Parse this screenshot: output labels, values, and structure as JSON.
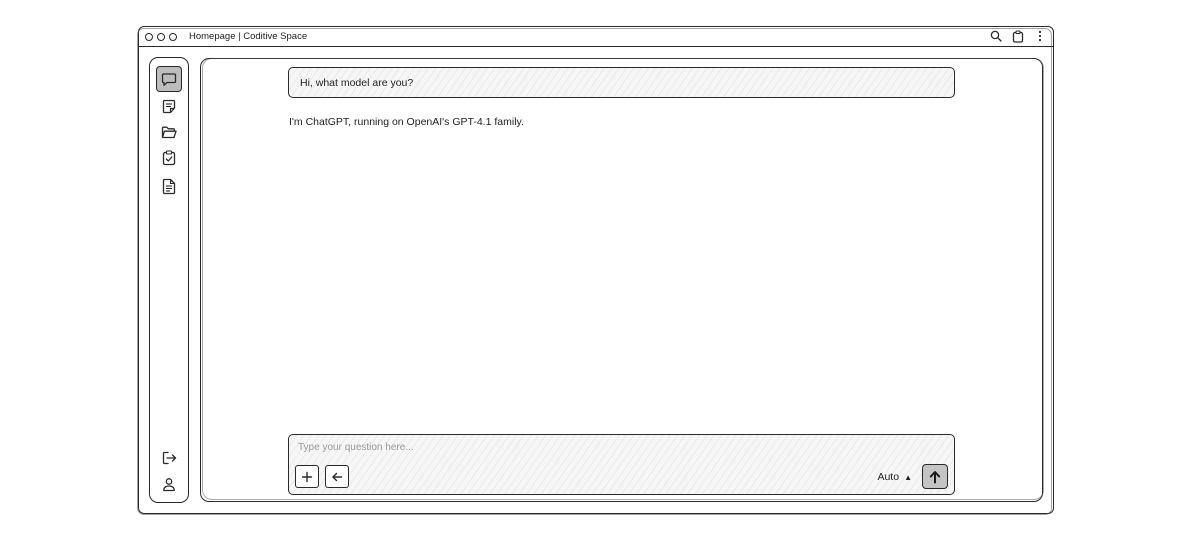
{
  "window": {
    "title": "Homepage | Coditive Space"
  },
  "sidebar": {
    "items": [
      {
        "icon": "chat-icon",
        "active": true
      },
      {
        "icon": "notes-icon"
      },
      {
        "icon": "folder-icon"
      },
      {
        "icon": "clipboard-check-icon"
      },
      {
        "icon": "document-icon"
      }
    ],
    "bottom": [
      {
        "icon": "logout-icon"
      },
      {
        "icon": "user-icon"
      }
    ]
  },
  "chat": {
    "user_message": "Hi, what model are you?",
    "assistant_message": "I'm ChatGPT, running on OpenAI's GPT-4.1 family."
  },
  "composer": {
    "placeholder": "Type your question here...",
    "model_label": "Auto",
    "model_caret": "▲"
  },
  "colors": {
    "stroke": "#2a2a2a",
    "active_fill": "#bdbdbd",
    "send_fill": "#c4c4c4",
    "placeholder": "#9a9a9a"
  }
}
